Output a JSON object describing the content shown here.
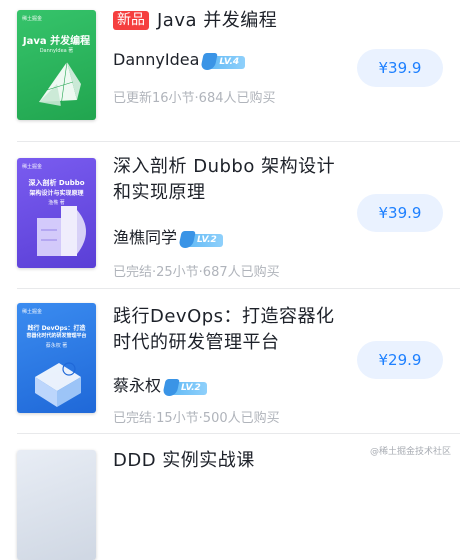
{
  "courses": [
    {
      "badge": "新品",
      "title": "Java 并发编程",
      "author": "DannyIdea",
      "level": "LV.4",
      "meta": "已更新16小节·684人已购买",
      "price": "¥39.9",
      "cover": {
        "brand": "稀土掘金",
        "title": "Java 并发编程",
        "subtitle": "DannyIdea 著",
        "color": "#2bb55e"
      }
    },
    {
      "title": "深入剖析 Dubbo 架构设计和实现原理",
      "author": "渔樵同学",
      "level": "LV.2",
      "meta": "已完结·25小节·687人已购买",
      "price": "¥39.9",
      "cover": {
        "brand": "稀土掘金",
        "title_line1": "深入剖析 Dubbo",
        "title_line2": "架构设计与实现原理",
        "subtitle": "渔樵 著",
        "color": "#6a4fe0"
      }
    },
    {
      "title": "践行DevOps：打造容器化时代的研发管理平台",
      "author": "蔡永权",
      "level": "LV.2",
      "meta": "已完结·15小节·500人已购买",
      "price": "¥29.9",
      "cover": {
        "brand": "稀土掘金",
        "title_line1": "践行 DevOps：打造",
        "title_line2": "容器化时代的研发管理平台",
        "subtitle": "蔡永权 著",
        "color": "#2a78e4"
      }
    },
    {
      "title": "DDD 实例实战课"
    }
  ],
  "watermark": "@稀土掘金技术社区"
}
